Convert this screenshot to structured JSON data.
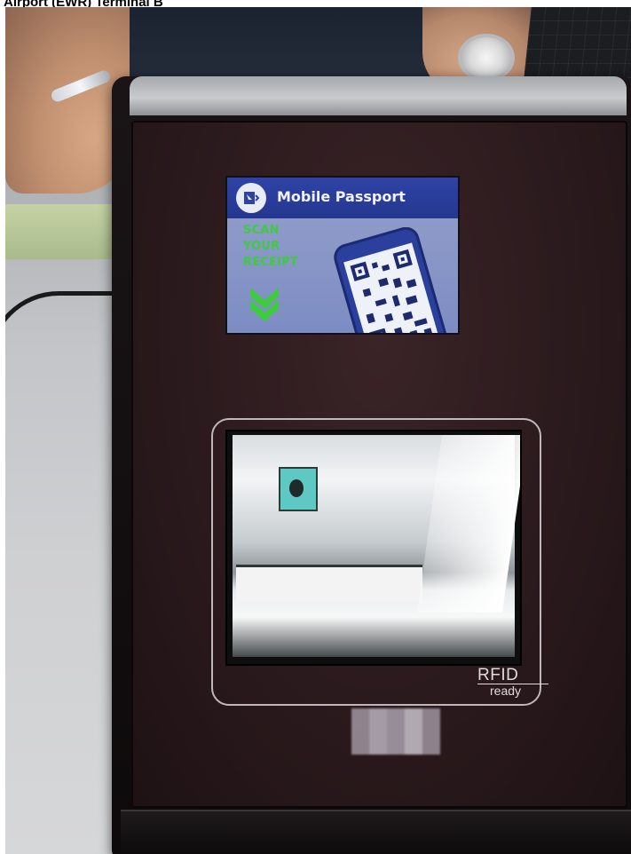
{
  "caption": "Airport (EWR) Terminal B",
  "screen": {
    "header_title": "Mobile Passport",
    "instructions": [
      "SCAN",
      "YOUR",
      "RECEIPT"
    ],
    "colors": {
      "header": "#2f43a6",
      "body": "#8e9bc9",
      "text_green": "#3ecb3f"
    },
    "icons": {
      "logo": "mobile-passport-logo-icon",
      "chevrons": "double-chevron-down-icon",
      "phone": "phone-qr-code-icon"
    }
  },
  "scanner": {
    "rfid_label": "RFID",
    "rfid_sub": "ready"
  }
}
